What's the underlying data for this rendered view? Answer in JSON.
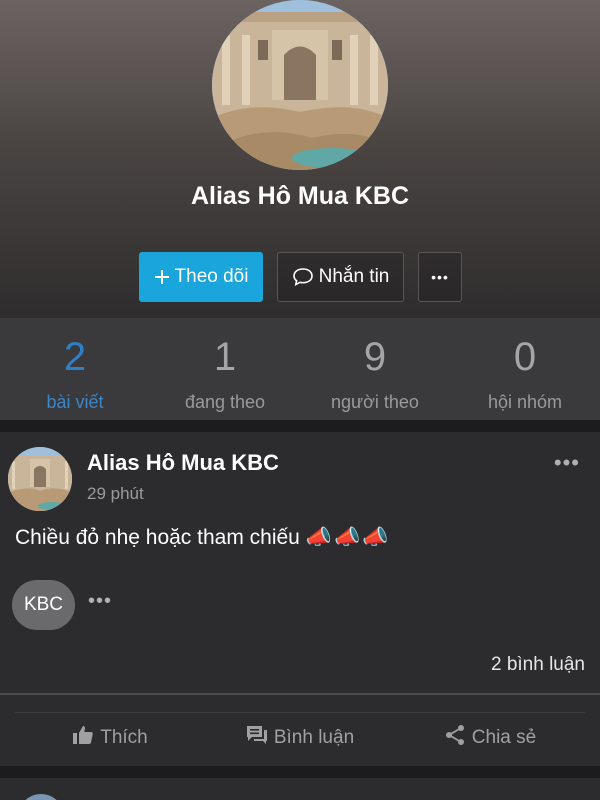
{
  "profile": {
    "name": "Alias Hô Mua KBC"
  },
  "actions": {
    "follow_label": "Theo dõi",
    "message_label": "Nhắn tin",
    "more_label": "•••"
  },
  "stats": [
    {
      "value": "2",
      "label": "bài viết"
    },
    {
      "value": "1",
      "label": "đang theo"
    },
    {
      "value": "9",
      "label": "người theo"
    },
    {
      "value": "0",
      "label": "hội nhóm"
    }
  ],
  "post": {
    "author": "Alias Hô Mua KBC",
    "time": "29 phút",
    "menu": "•••",
    "text": "Chiều đỏ nhẹ hoặc tham chiếu",
    "emoji": [
      "📣",
      "📣",
      "📣"
    ],
    "reactor_initials": "KBC",
    "reactor_more": "•••",
    "comment_count": "2 bình luận",
    "like_label": "Thích",
    "comment_label": "Bình luận",
    "share_label": "Chia sẻ"
  },
  "colors": {
    "accent": "#1aa5dc",
    "active_stat": "#2f7fc8",
    "background": "#1c1c1e",
    "card": "#2c2c2e"
  }
}
